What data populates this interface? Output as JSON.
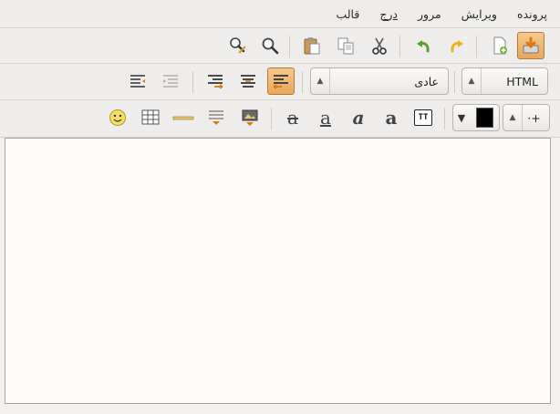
{
  "menubar": {
    "items": [
      "پرونده",
      "ویرایش",
      "مرور",
      "درج",
      "قالب"
    ]
  },
  "toolbar1": {
    "buttons": [
      "save-icon",
      "new-document-icon",
      "redo-icon",
      "undo-icon",
      "cut-icon",
      "copy-icon",
      "paste-icon",
      "find-icon",
      "find-replace-icon"
    ]
  },
  "toolbar2": {
    "format_combo": {
      "value": "HTML"
    },
    "paragraph_combo": {
      "value": "عادی"
    },
    "buttons": [
      "align-left-icon",
      "align-center-icon",
      "align-right-icon",
      "indent-icon",
      "outdent-icon"
    ]
  },
  "toolbar3": {
    "font_size_label": "·+",
    "text_color": "#000000",
    "buttons": [
      "teletype-icon",
      "bold-icon",
      "italic-icon",
      "underline-icon",
      "strikethrough-icon",
      "insert-image-icon",
      "insert-link-icon",
      "horizontal-rule-icon",
      "table-icon",
      "smiley-icon"
    ]
  },
  "colors": {
    "accent": "#e8a85c",
    "toolbar_bg": "#efedeb",
    "editor_bg": "#fdfcfb"
  }
}
